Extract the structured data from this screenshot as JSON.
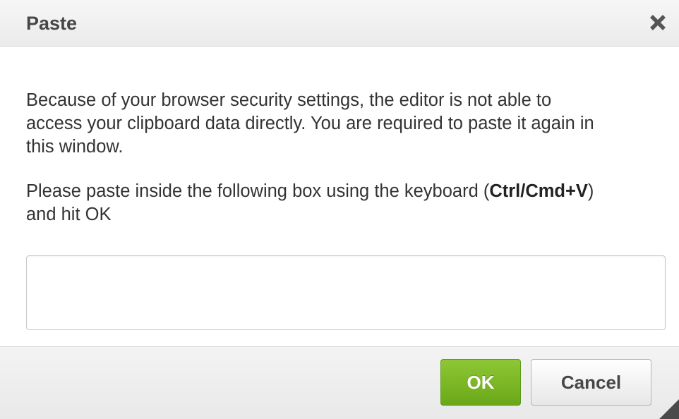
{
  "dialog": {
    "title": "Paste",
    "close_icon": "close-icon",
    "message": {
      "line1": "Because of your browser security settings, the editor is not able to access your clipboard data directly. You are required to paste it again in this window.",
      "instruction_prefix": "Please paste inside the following box using the keyboard (",
      "instruction_shortcut": "Ctrl/Cmd+V",
      "instruction_suffix": ") and hit OK"
    },
    "paste_box": {
      "value": "",
      "placeholder": ""
    },
    "buttons": {
      "ok_label": "OK",
      "cancel_label": "Cancel"
    },
    "resize_icon": "resize-grip-icon"
  },
  "colors": {
    "ok_button": "#7ab929",
    "title_text": "#474747",
    "body_text": "#333333"
  }
}
